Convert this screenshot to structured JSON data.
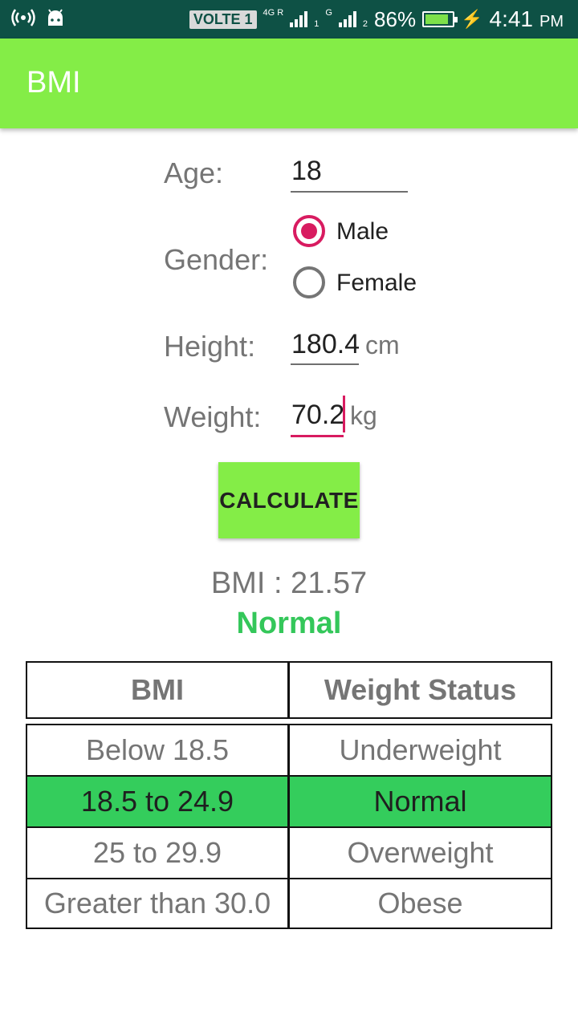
{
  "status_bar": {
    "volte": "VOLTE 1",
    "net1_label": "4G R",
    "sim1": "1",
    "net2_label": "G",
    "sim2": "2",
    "battery_percent": "86%",
    "time": "4:41",
    "ampm": "PM",
    "icons": [
      "hotspot-icon",
      "android-icon",
      "signal-icon",
      "battery-icon",
      "charging-icon"
    ]
  },
  "appbar": {
    "title": "BMI",
    "color": "#84ed47"
  },
  "form": {
    "age_label": "Age:",
    "age_value": "18",
    "gender_label": "Gender:",
    "gender_options": [
      {
        "label": "Male",
        "checked": true
      },
      {
        "label": "Female",
        "checked": false
      }
    ],
    "height_label": "Height:",
    "height_value": "180.4",
    "height_unit": "cm",
    "weight_label": "Weight:",
    "weight_value": "70.2",
    "weight_unit": "kg"
  },
  "calculate_label": "CALCULATE",
  "result": {
    "bmi_text": "BMI : 21.57",
    "status": "Normal"
  },
  "table": {
    "headers": [
      "BMI",
      "Weight Status"
    ],
    "rows": [
      {
        "bmi": "Below 18.5",
        "status": "Underweight"
      },
      {
        "bmi": "18.5 to 24.9",
        "status": "Normal"
      },
      {
        "bmi": "25 to 29.9",
        "status": "Overweight"
      },
      {
        "bmi": "Greater than 30.0",
        "status": "Obese"
      }
    ],
    "highlight_color": "#34cd5c"
  },
  "colors": {
    "accent": "#d81b60",
    "status_bar": "#0e5145",
    "normal_text": "#34c75a"
  }
}
